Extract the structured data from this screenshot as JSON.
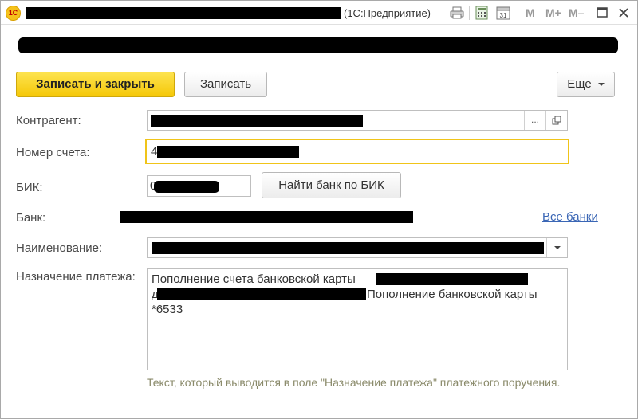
{
  "window": {
    "title_suffix": "(1С:Предприятие)",
    "toolbar_m_labels": [
      "M",
      "M+",
      "M–"
    ],
    "calendar_day": "31"
  },
  "toolbar": {
    "save_close_label": "Записать и закрыть",
    "save_label": "Записать",
    "more_label": "Еще"
  },
  "form": {
    "counterparty_label": "Контрагент:",
    "select_dots": "...",
    "account_label": "Номер счета:",
    "account_value_prefix": "4",
    "bik_label": "БИК:",
    "bik_value_prefix": "0",
    "find_bank_label": "Найти банк по БИК",
    "bank_label": "Банк:",
    "all_banks_link": "Все банки",
    "name_label": "Наименование:",
    "purpose_label": "Назначение платежа:",
    "purpose_line1": "Пополнение счета банковской карты",
    "purpose_line2_prefix": "д",
    "purpose_line2_suffix": "Пополнение банковской карты",
    "purpose_line3": "*6533",
    "hint_text": "Текст, который выводится в поле \"Назначение платежа\" платежного поручения."
  },
  "colors": {
    "primary_button": "#f5c808",
    "focus_border": "#f0c419",
    "link": "#3a66b5",
    "hint": "#8a8a6a"
  },
  "icons": {
    "app_logo": "1c-logo-icon",
    "print": "printer-icon",
    "calculator": "calculator-icon",
    "calendar": "calendar-icon",
    "minimize": "minimize-icon",
    "maximize": "maximize-icon",
    "close": "close-icon",
    "open": "open-form-icon",
    "dropdown": "chevron-down-icon"
  }
}
